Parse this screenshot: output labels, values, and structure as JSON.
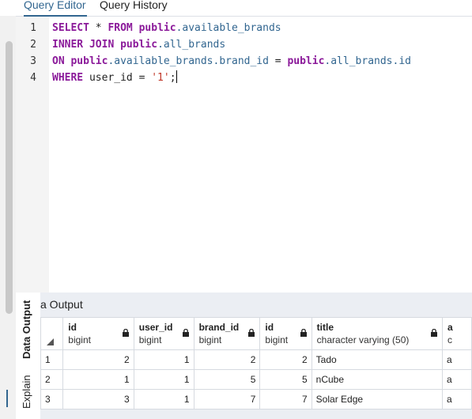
{
  "tabs": {
    "query_editor": "Query Editor",
    "query_history": "Query History"
  },
  "editor": {
    "line_numbers": [
      "1",
      "2",
      "3",
      "4"
    ],
    "lines": [
      [
        {
          "text": "SELECT",
          "style": "kw"
        },
        {
          "text": " * ",
          "style": "plain"
        },
        {
          "text": "FROM",
          "style": "kw"
        },
        {
          "text": " ",
          "style": "plain"
        },
        {
          "text": "public",
          "style": "kw"
        },
        {
          "text": ".available_brands",
          "style": "tbl"
        }
      ],
      [
        {
          "text": "INNER JOIN",
          "style": "kw"
        },
        {
          "text": " ",
          "style": "plain"
        },
        {
          "text": "public",
          "style": "kw"
        },
        {
          "text": ".all_brands",
          "style": "tbl"
        }
      ],
      [
        {
          "text": "ON",
          "style": "kw"
        },
        {
          "text": " ",
          "style": "plain"
        },
        {
          "text": "public",
          "style": "kw"
        },
        {
          "text": ".available_brands.brand_id",
          "style": "tbl"
        },
        {
          "text": " = ",
          "style": "plain"
        },
        {
          "text": "public",
          "style": "kw"
        },
        {
          "text": ".all_brands.id",
          "style": "tbl"
        }
      ],
      [
        {
          "text": "WHERE",
          "style": "kw"
        },
        {
          "text": " user_id = ",
          "style": "plain"
        },
        {
          "text": "'1'",
          "style": "str"
        },
        {
          "text": ";",
          "style": "plain"
        }
      ]
    ]
  },
  "output": {
    "side_tabs": {
      "data_output": "Data Output",
      "explain": "Explain"
    },
    "panel_title": "a Output",
    "columns": [
      {
        "name": "id",
        "type": "bigint"
      },
      {
        "name": "user_id",
        "type": "bigint"
      },
      {
        "name": "brand_id",
        "type": "bigint"
      },
      {
        "name": "id",
        "type": "bigint"
      },
      {
        "name": "title",
        "type": "character varying (50)"
      },
      {
        "name": "a",
        "type": "c"
      }
    ],
    "rows": [
      {
        "rownum": "1",
        "cells": [
          "2",
          "1",
          "2",
          "2",
          "Tado",
          "a"
        ]
      },
      {
        "rownum": "2",
        "cells": [
          "1",
          "1",
          "5",
          "5",
          "nCube",
          "a"
        ]
      },
      {
        "rownum": "3",
        "cells": [
          "3",
          "1",
          "7",
          "7",
          "Solar Edge",
          "a"
        ]
      }
    ]
  },
  "colors": {
    "accent": "#326690",
    "keyword": "#8b1a9a",
    "string": "#c0392b"
  },
  "icons": [
    "lock-icon",
    "sort-corner-icon"
  ]
}
